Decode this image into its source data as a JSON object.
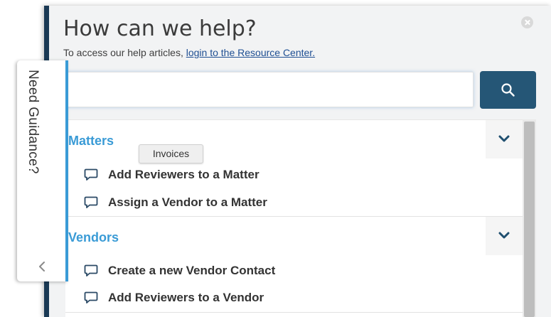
{
  "header": {
    "title": "How can we help?",
    "subtitle_prefix": "To access our help articles, ",
    "subtitle_link": "login to the Resource Center."
  },
  "search": {
    "value": "",
    "placeholder": "",
    "button_icon": "search-icon"
  },
  "guidance_tab": {
    "label": "Need Guidance?",
    "icon": "chevron-left-icon"
  },
  "tooltip": {
    "text": "Invoices"
  },
  "sections": [
    {
      "title": "Matters",
      "icon": "chevron-down-icon",
      "articles": [
        {
          "label": "Add Reviewers to a Matter",
          "icon": "speech-bubble-icon"
        },
        {
          "label": "Assign a Vendor to a Matter",
          "icon": "speech-bubble-icon"
        }
      ]
    },
    {
      "title": "Vendors",
      "icon": "chevron-down-icon",
      "articles": [
        {
          "label": "Create a new Vendor Contact",
          "icon": "speech-bubble-icon"
        },
        {
          "label": "Add Reviewers to a Vendor",
          "icon": "speech-bubble-icon"
        }
      ]
    }
  ],
  "colors": {
    "accent": "#3a9bd6",
    "search_button": "#255676",
    "panel_edge": "#1b3a55",
    "link": "#1f4f93"
  }
}
